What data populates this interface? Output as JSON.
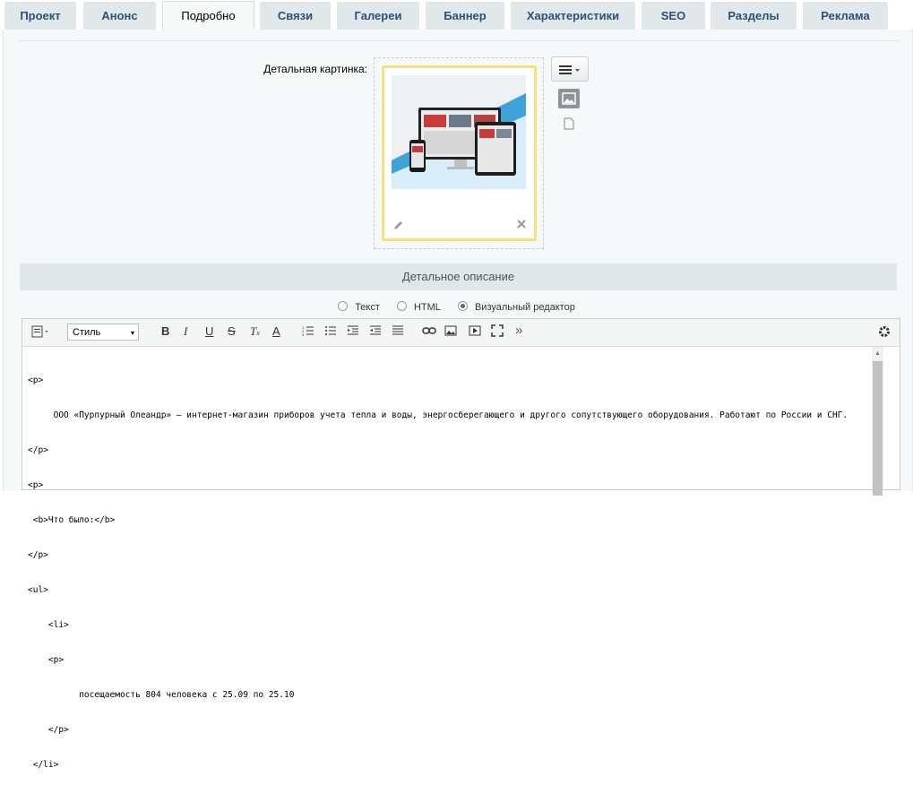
{
  "tabs": [
    {
      "label": "Проект",
      "active": false
    },
    {
      "label": "Анонс",
      "active": false
    },
    {
      "label": "Подробно",
      "active": true
    },
    {
      "label": "Связи",
      "active": false
    },
    {
      "label": "Галереи",
      "active": false
    },
    {
      "label": "Баннер",
      "active": false
    },
    {
      "label": "Характеристики",
      "active": false
    },
    {
      "label": "SEO",
      "active": false
    },
    {
      "label": "Разделы",
      "active": false
    },
    {
      "label": "Реклама",
      "active": false
    }
  ],
  "detail_image": {
    "label": "Детальная картинка:",
    "edit_icon": "pencil-icon",
    "delete_icon": "close-icon"
  },
  "description": {
    "header": "Детальное описание",
    "modes": {
      "text": "Текст",
      "html": "HTML",
      "visual": "Визуальный редактор",
      "selected": "visual"
    }
  },
  "editor": {
    "style_select": "Стиль",
    "toolbar_icons": [
      "bold-icon",
      "italic-icon",
      "underline-icon",
      "strike-icon",
      "remove-format-icon",
      "font-color-icon",
      "ordered-list-icon",
      "unordered-list-icon",
      "outdent-icon",
      "indent-icon",
      "align-icon",
      "link-icon",
      "image-icon",
      "video-icon",
      "fullscreen-icon",
      "more-icon",
      "settings-icon"
    ],
    "lines": [
      "<p>",
      "     ООО «Пурпурный Олеандр» — интернет-магазин приборов учета тепла и воды, энергосберегающего и другого сопутствующего оборудования. Работают по России и СНГ.",
      "</p>",
      "<p>",
      " <b>Что было:</b>",
      "</p>",
      "<ul>",
      "    <li>",
      "    <p>",
      "          посещаемость 804 человека с 25.09 по 25.10",
      "    </p>",
      " </li>"
    ]
  }
}
